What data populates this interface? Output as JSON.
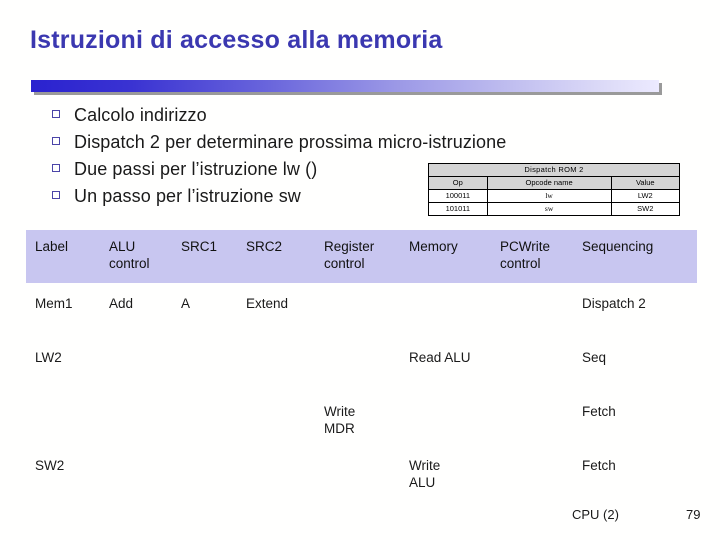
{
  "slide": {
    "title": "Istruzioni di accesso alla memoria",
    "title_color": "#3b38b0",
    "bullet_color": "#4b45a8",
    "header_band_color": "#c8c6f0"
  },
  "bullets": [
    {
      "glyph": "square-bullet",
      "text": "Calcolo indirizzo"
    },
    {
      "glyph": "square-bullet",
      "text": "Dispatch 2 per determinare prossima micro-istruzione"
    },
    {
      "glyph": "square-bullet",
      "text": "Due passi per l’istruzione lw ()"
    },
    {
      "glyph": "square-bullet",
      "text": "Un passo per l’istruzione sw"
    }
  ],
  "rom_table": {
    "title": "Dispatch ROM 2",
    "columns": [
      "Op",
      "Opcode name",
      "Value"
    ],
    "rows": [
      {
        "op": "100011",
        "opcode_name": "lw",
        "value": "LW2"
      },
      {
        "op": "101011",
        "opcode_name": "sw",
        "value": "SW2"
      }
    ]
  },
  "microcode_table": {
    "headers": {
      "label": "Label",
      "alu_control": "ALU\ncontrol",
      "src1": "SRC1",
      "src2": "SRC2",
      "register_control": "Register\ncontrol",
      "memory": "Memory",
      "pcwrite_control": "PCWrite\ncontrol",
      "sequencing": "Sequencing"
    },
    "rows": [
      {
        "label": "Mem1",
        "alu_control": "Add",
        "src1": "A",
        "src2": "Extend",
        "register_control": "",
        "memory": "",
        "pcwrite_control": "",
        "sequencing": "Dispatch 2"
      },
      {
        "label": "LW2",
        "alu_control": "",
        "src1": "",
        "src2": "",
        "register_control": "",
        "memory": "Read ALU",
        "pcwrite_control": "",
        "sequencing": "Seq"
      },
      {
        "label": "",
        "alu_control": "",
        "src1": "",
        "src2": "",
        "register_control": "Write\nMDR",
        "memory": "",
        "pcwrite_control": "",
        "sequencing": "Fetch"
      },
      {
        "label": "SW2",
        "alu_control": "",
        "src1": "",
        "src2": "",
        "register_control": "",
        "memory": "Write\nALU",
        "pcwrite_control": "",
        "sequencing": "Fetch"
      }
    ]
  },
  "footer": {
    "label": "CPU (2)",
    "page_number": "79"
  }
}
